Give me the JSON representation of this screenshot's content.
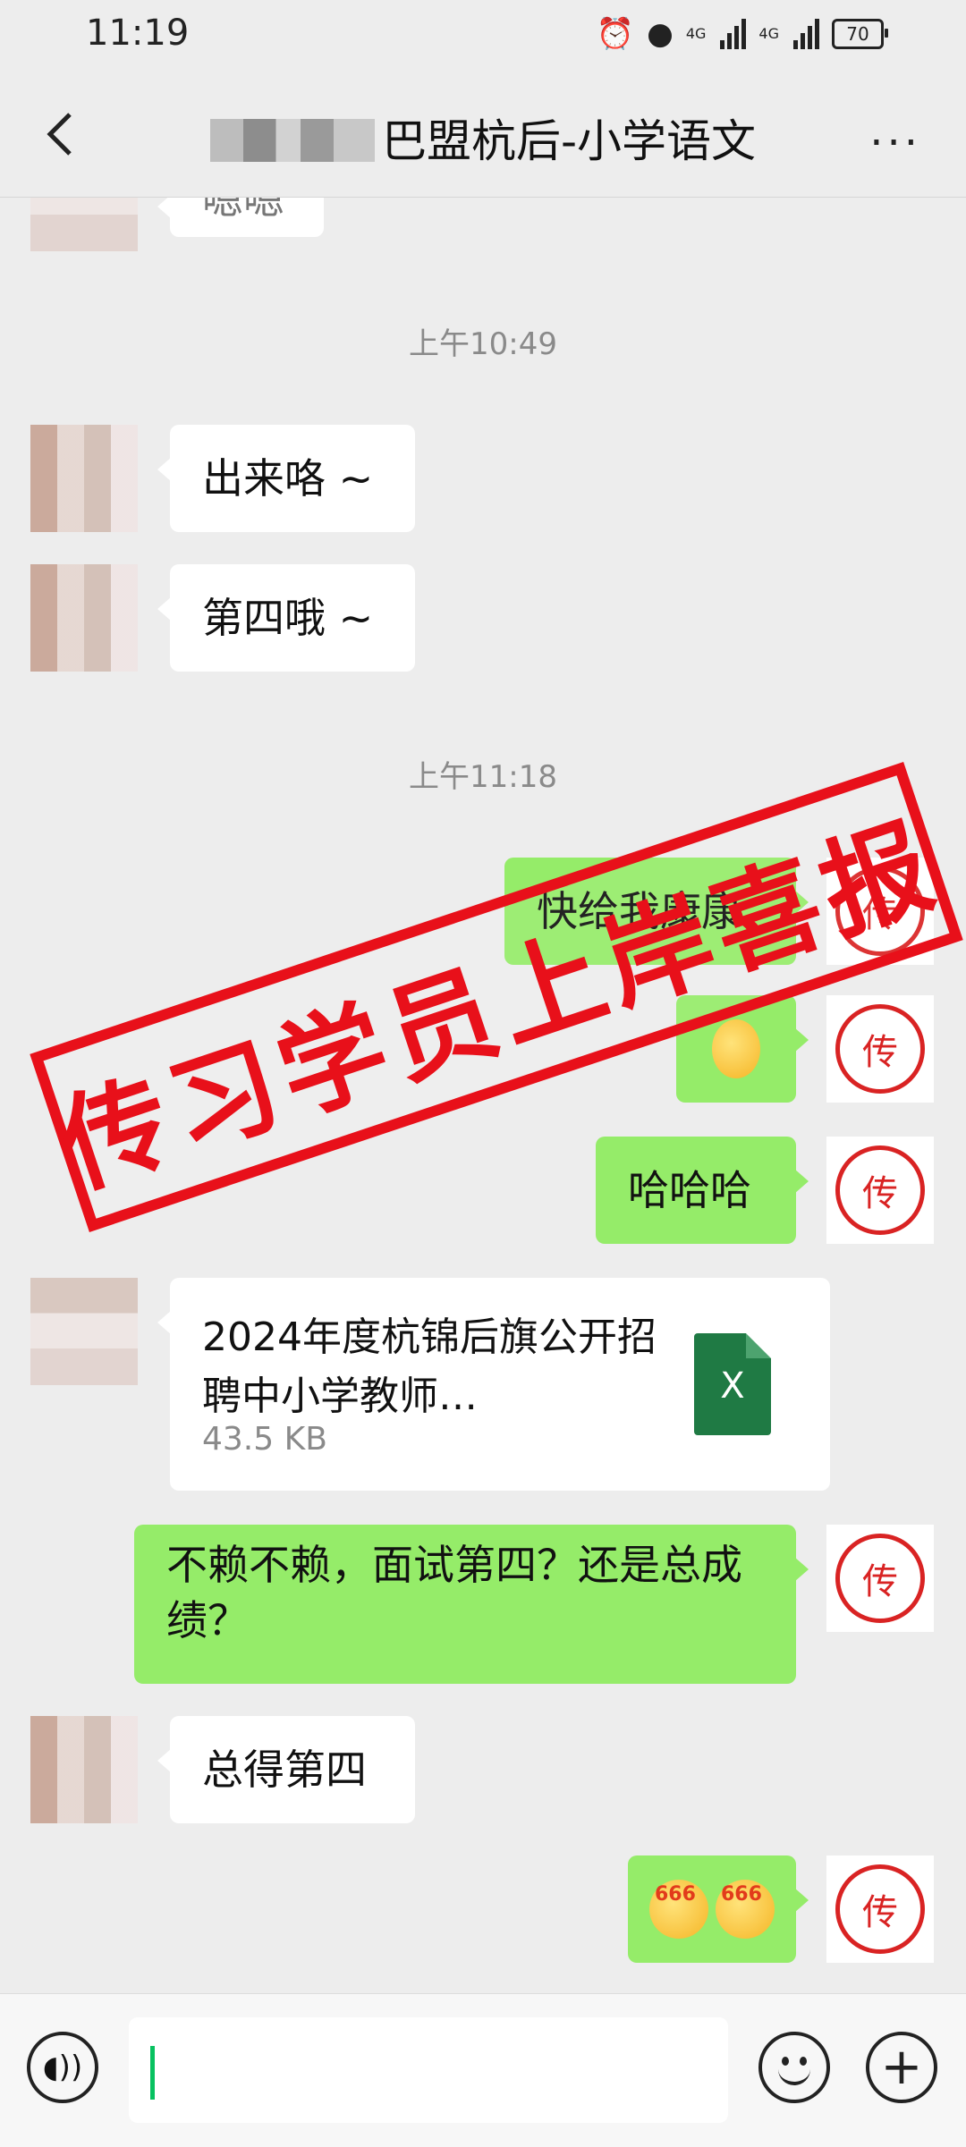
{
  "status_bar": {
    "time": "11:19",
    "network_1": "4G",
    "network_2": "4G",
    "battery": "70"
  },
  "header": {
    "title": "巴盟杭后-小学语文",
    "more": "···",
    "back_icon": "chevron-left-icon"
  },
  "chat": {
    "partial_message": "嗯嗯",
    "timestamp_1": "上午10:49",
    "msg_1": "出来咯 ~",
    "msg_2": "第四哦 ~",
    "timestamp_2": "上午11:18",
    "msg_3": "快给我康康",
    "msg_4": "哈哈哈",
    "file": {
      "name": "2024年度杭锦后旗公开招聘中小学教师…",
      "size": "43.5 KB",
      "icon_letter": "X"
    },
    "msg_5": "不赖不赖，面试第四？还是总成绩？",
    "msg_6": "总得第四",
    "emoji_caption": "666"
  },
  "seal": {
    "char": "传"
  },
  "overlay_stamp": "传习学员上岸喜报",
  "input_bar": {
    "voice_icon": "voice-icon",
    "emoji_icon": "smiley-icon",
    "plus_icon": "plus-icon",
    "value": ""
  }
}
